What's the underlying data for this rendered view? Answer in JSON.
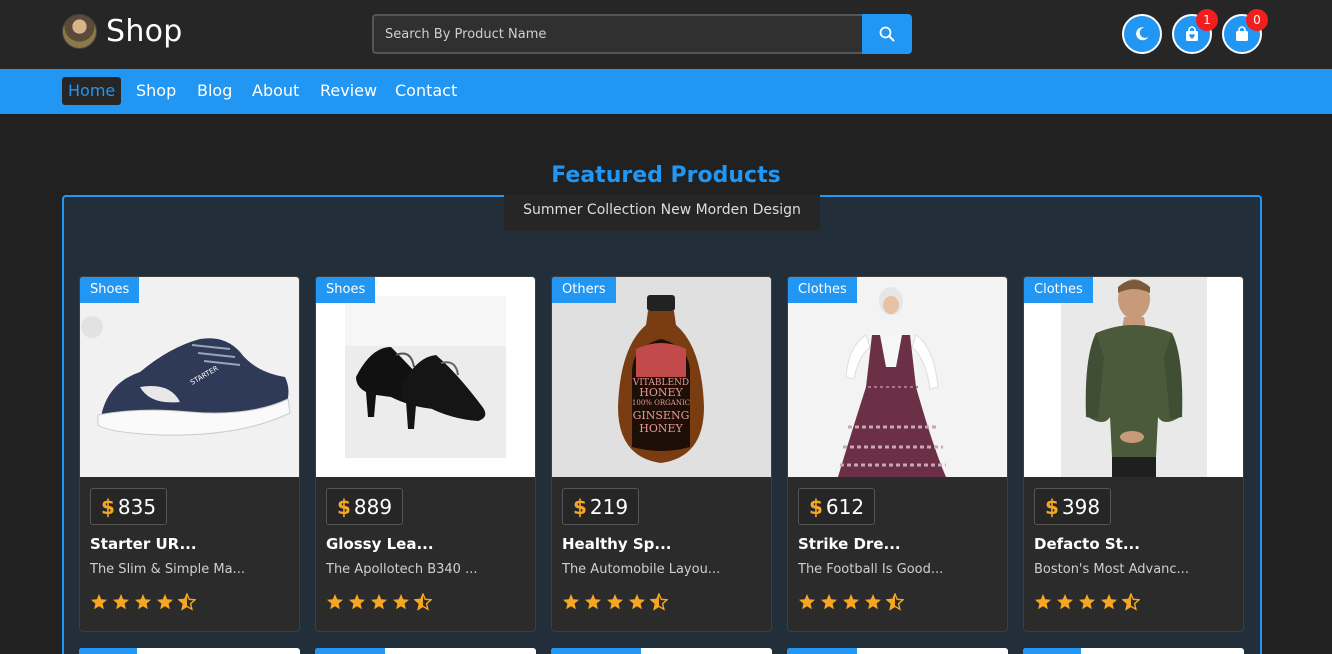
{
  "header": {
    "brand": "Shop",
    "search_placeholder": "Search By Product Name",
    "wishlist_count": "1",
    "cart_count": "0"
  },
  "nav": {
    "items": [
      "Home",
      "Shop",
      "Blog",
      "About",
      "Review",
      "Contact"
    ],
    "active": "Home"
  },
  "section": {
    "title": "Featured Products",
    "subtitle": "Summer Collection New Morden Design"
  },
  "colors": {
    "accent": "#2196f3",
    "price_symbol": "#f5a623",
    "star": "#f5a623",
    "badge": "#f21d1d"
  },
  "products": [
    {
      "category": "Shoes",
      "currency": "$",
      "price": "835",
      "name": "Starter UR...",
      "desc": "The Slim & Simple Ma...",
      "rating": 4.5,
      "image": "sneaker"
    },
    {
      "category": "Shoes",
      "currency": "$",
      "price": "889",
      "name": "Glossy Lea...",
      "desc": "The Apollotech B340 ...",
      "rating": 4.5,
      "image": "heels"
    },
    {
      "category": "Others",
      "currency": "$",
      "price": "219",
      "name": "Healthy Sp...",
      "desc": "The Automobile Layou...",
      "rating": 4.5,
      "image": "honey-bottle"
    },
    {
      "category": "Clothes",
      "currency": "$",
      "price": "612",
      "name": "Strike Dre...",
      "desc": "The Football Is Good...",
      "rating": 4.5,
      "image": "dress"
    },
    {
      "category": "Clothes",
      "currency": "$",
      "price": "398",
      "name": "Defacto St...",
      "desc": "Boston's Most Advanc...",
      "rating": 4.5,
      "image": "sweater"
    }
  ],
  "honey_label": {
    "brand": "VITABLEND",
    "line1": "HONEY",
    "line2": "100% ORGANIC",
    "line3": "GINSENG",
    "line4": "HONEY"
  },
  "sneaker_text": "STARTER"
}
